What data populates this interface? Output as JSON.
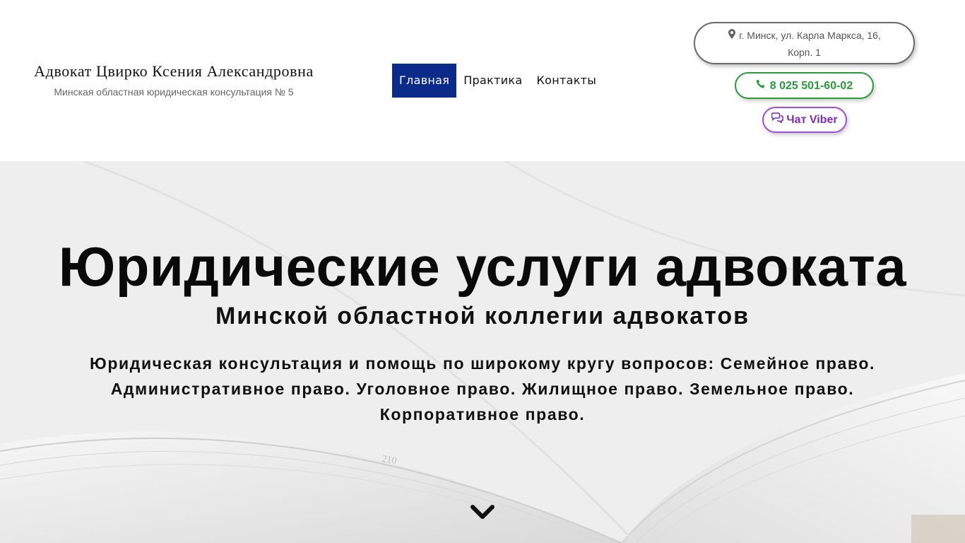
{
  "header": {
    "brand_title": "Адвокат Цвирко Ксения Александровна",
    "brand_subtitle": "Минская областная юридическая консультация № 5",
    "nav": [
      {
        "label": "Главная",
        "active": true
      },
      {
        "label": "Практика",
        "active": false
      },
      {
        "label": "Контакты",
        "active": false
      }
    ],
    "address_line1": "г. Минск, ул. Карла Маркса, 16,",
    "address_line2": "Корп. 1",
    "phone": "8 025 501-60-02",
    "viber": "Чат Viber"
  },
  "hero": {
    "title": "Юридические услуги адвоката",
    "subtitle": "Минской областной коллегии адвокатов",
    "text": "Юридическая консультация и помощь по широкому кругу вопросов: Семейное право. Административное право. Уголовное право. Жилищное право. Земельное право. Корпоративное право.",
    "page_number": "210"
  },
  "colors": {
    "nav_active": "#0a2b8a",
    "phone": "#2a9a3e",
    "viber": "#7a2fb3"
  },
  "icons": {
    "address": "map-marker-icon",
    "phone": "phone-icon",
    "viber": "chat-icon",
    "scroll": "chevron-down-icon"
  }
}
